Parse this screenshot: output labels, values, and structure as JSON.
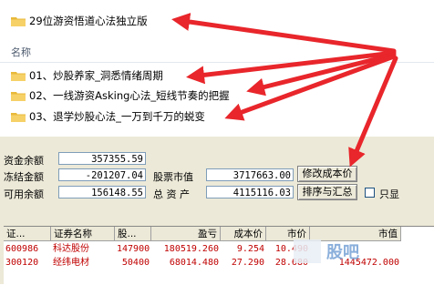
{
  "explorer": {
    "top_folder": "29位游资悟道心法独立版",
    "column_header": "名称",
    "folders": [
      "01、炒股养家_洞悉情绪周期",
      "02、一线游资Asking心法_短线节奏的把握",
      "03、退学炒股心法_一万到千万的蜕变"
    ]
  },
  "account": {
    "cash_balance_label": "资金余额",
    "cash_balance": "357355.59",
    "frozen_label": "冻结金额",
    "frozen": "-201207.04",
    "available_label": "可用余额",
    "available": "156148.55",
    "stock_value_label": "股票市值",
    "stock_value": "3717663.00",
    "total_assets_label": "总 资 产",
    "total_assets": "4115116.03",
    "modify_cost_button": "修改成本价",
    "sort_summary_button": "排序与汇总",
    "only_show_label": "只显"
  },
  "table": {
    "headers": [
      "证...",
      "证券名称",
      "股...",
      "盈亏",
      "成本价",
      "市价",
      "市值"
    ],
    "rows": [
      {
        "code": "600986",
        "name": "科达股份",
        "shares": "147900",
        "pnl": "180519.260",
        "cost": "9.254",
        "price": "10.490",
        "value": ""
      },
      {
        "code": "300120",
        "name": "经纬电材",
        "shares": "50400",
        "pnl": "68014.480",
        "cost": "27.290",
        "price": "28.680",
        "value": "1445472.000"
      }
    ]
  },
  "watermark": {
    "text": "股吧"
  },
  "colors": {
    "arrow": "#e8262b",
    "row_text": "#c00000",
    "panel_bg": "#ece9d8"
  }
}
